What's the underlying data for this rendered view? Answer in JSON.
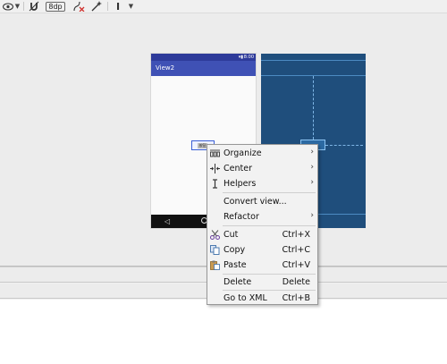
{
  "toolbar": {
    "show_caret": "▼",
    "default_margin": "8dp",
    "text_cursor_icon": "I",
    "icons": [
      "eye-icon",
      "magnet-icon",
      "margin-dp-field",
      "clear-constraints-icon",
      "infer-constraints-icon",
      "guidelines-icon"
    ]
  },
  "phone": {
    "app_title": "View2",
    "status_time": "8:00",
    "status_icons": "▾▮",
    "widget_text": "按钮",
    "nav_back": "◁"
  },
  "context_menu": {
    "items": [
      {
        "label": "Organize",
        "icon": "organize-icon",
        "submenu": true
      },
      {
        "label": "Center",
        "icon": "center-icon",
        "submenu": true
      },
      {
        "label": "Helpers",
        "icon": "helpers-icon",
        "submenu": true
      },
      {
        "label": "Convert view...",
        "icon": "",
        "submenu": false
      },
      {
        "label": "Refactor",
        "icon": "",
        "submenu": true
      },
      {
        "label": "Cut",
        "icon": "scissors-icon",
        "shortcut": "Ctrl+X"
      },
      {
        "label": "Copy",
        "icon": "copy-icon",
        "shortcut": "Ctrl+C"
      },
      {
        "label": "Paste",
        "icon": "paste-icon",
        "shortcut": "Ctrl+V"
      },
      {
        "label": "Delete",
        "icon": "",
        "shortcut": "Delete"
      },
      {
        "label": "Go to XML",
        "icon": "",
        "shortcut": "Ctrl+B"
      }
    ],
    "arrow": "›"
  },
  "colors": {
    "appbar": "#3f51b5",
    "statusbar": "#2d3a9a",
    "blueprint_bg": "#1f4e7c",
    "selection": "#3a5fd6"
  }
}
